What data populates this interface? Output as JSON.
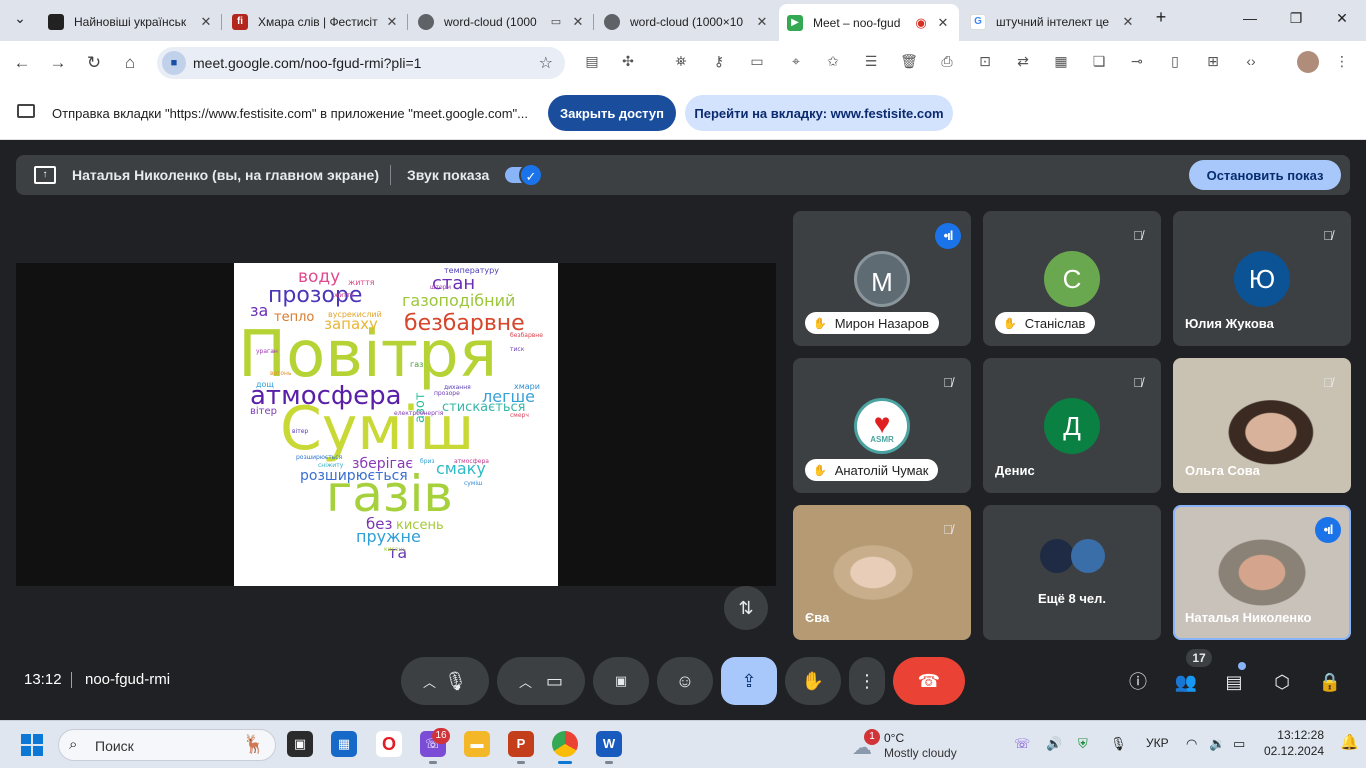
{
  "browser": {
    "tabs": [
      {
        "title": "Найновіші українськ",
        "favicon_color": "#222222",
        "favicon_glyph": ""
      },
      {
        "title": "Хмара слів | Фестисіт",
        "favicon_color": "#b3261e",
        "favicon_glyph": "fi"
      },
      {
        "title": "word-cloud (1000",
        "favicon_color": "#5f6368",
        "favicon_glyph": "◍"
      },
      {
        "title": "word-cloud (1000×10",
        "favicon_color": "#5f6368",
        "favicon_glyph": "◍"
      },
      {
        "title": "Meet – noo-fgud",
        "favicon_color": "#34a853",
        "favicon_glyph": "▶"
      },
      {
        "title": "штучний інтелект це",
        "favicon_color": "#4285f4",
        "favicon_glyph": "G"
      }
    ],
    "url": "meet.google.com/noo-fgud-rmi?pli=1",
    "new_tab_icon": "plus-icon",
    "extension_icons": [
      "pdf-icon",
      "puzzle-icon",
      "spy-icon",
      "key-icon",
      "card-icon",
      "location-icon",
      "star-icon",
      "notes-icon",
      "trash-icon",
      "print-icon",
      "screenshot-icon",
      "translate-icon",
      "qr-icon",
      "reader-icon",
      "link-icon",
      "devices-icon",
      "grid-icon",
      "code-icon"
    ]
  },
  "infobar": {
    "message": "Отправка вкладки \"https://www.festisite.com\" в приложение \"meet.google.com\"...",
    "stop_sharing": "Закрыть доступ",
    "goto_tab": "Перейти на вкладку: www.festisite.com"
  },
  "presenting": {
    "presenter": "Наталья Николенко (вы, на главном экране)",
    "sound_label": "Звук показа",
    "stop_label": "Остановить показ"
  },
  "wordcloud": {
    "words": [
      {
        "text": "Повітря",
        "color": "#b5d334"
      },
      {
        "text": "Суміш",
        "color": "#c8d936"
      },
      {
        "text": "газів",
        "color": "#a6d13d"
      },
      {
        "text": "атмосфера",
        "color": "#5a1fa8"
      },
      {
        "text": "безбарвне",
        "color": "#d5462b"
      },
      {
        "text": "прозоре",
        "color": "#4b36b8"
      },
      {
        "text": "газоподібний",
        "color": "#9cc63a"
      },
      {
        "text": "стан",
        "color": "#6b2fb3"
      },
      {
        "text": "воду",
        "color": "#e04a8f"
      },
      {
        "text": "запаху",
        "color": "#e8b534"
      },
      {
        "text": "легше",
        "color": "#3aa0d8"
      },
      {
        "text": "стискається",
        "color": "#38b7a8"
      },
      {
        "text": "зберігає",
        "color": "#8a39b8"
      },
      {
        "text": "смаку",
        "color": "#30b9c6"
      },
      {
        "text": "розширюється",
        "color": "#3a6fd0"
      },
      {
        "text": "кисень",
        "color": "#a6c93a"
      },
      {
        "text": "пружне",
        "color": "#2f9fd6"
      },
      {
        "text": "без",
        "color": "#7a36b0"
      },
      {
        "text": "та",
        "color": "#6a3ab0"
      },
      {
        "text": "за",
        "color": "#6b2fb3"
      },
      {
        "text": "тепло",
        "color": "#d97a2b"
      },
      {
        "text": "азот",
        "color": "#2fbf9a"
      },
      {
        "text": "вітер",
        "color": "#7b3db5"
      },
      {
        "text": "життя",
        "color": "#d94a8a"
      },
      {
        "text": "вусрекислий",
        "color": "#e0a52e"
      },
      {
        "text": "дихання",
        "color": "#5c3eb6"
      },
      {
        "text": "хмари",
        "color": "#2d8fd0"
      },
      {
        "text": "ураган",
        "color": "#a13ab5"
      },
      {
        "text": "бриз",
        "color": "#35a2d4"
      },
      {
        "text": "шторм",
        "color": "#a03bb0"
      },
      {
        "text": "температуру",
        "color": "#4d3fb6"
      },
      {
        "text": "смерч",
        "color": "#d7485e"
      },
      {
        "text": "вогонь",
        "color": "#e0932e"
      },
      {
        "text": "сніжиту",
        "color": "#35b0c8"
      },
      {
        "text": "прозоре",
        "color": "#6c3cb6"
      },
      {
        "text": "суміш",
        "color": "#3a8bd4"
      },
      {
        "text": "кисень",
        "color": "#9fc83a"
      },
      {
        "text": "дощ",
        "color": "#2fa0d6"
      },
      {
        "text": "атмосфера",
        "color": "#c73a8e"
      },
      {
        "text": "тиск",
        "color": "#6c3fb8"
      },
      {
        "text": "газ",
        "color": "#4a9d3a"
      },
      {
        "text": "електроенергія",
        "color": "#7d3bb5"
      },
      {
        "text": "безбарвне",
        "color": "#dd3f4e"
      },
      {
        "text": "розширюється",
        "color": "#2d77d0"
      },
      {
        "text": "вітер",
        "color": "#5a3cb6"
      },
      {
        "text": "життя",
        "color": "#c93b8a"
      }
    ]
  },
  "participants": [
    {
      "name": "Мирон Назаров",
      "initial": "М",
      "avatar_color": "#5f6b73",
      "mic": "active",
      "chip": true
    },
    {
      "name": "Станіслав",
      "initial": "С",
      "avatar_color": "#6aa84f",
      "mic": "muted",
      "chip": true
    },
    {
      "name": "Юлия Жукова",
      "initial": "Ю",
      "avatar_color": "#0b5394",
      "mic": "muted",
      "chip": false
    },
    {
      "name": "Анатолій Чумак",
      "initial": "",
      "avatar_color": "#ffffff",
      "mic": "muted",
      "chip": true,
      "avatar_icon": "asmr-heart-icon",
      "avatar_text": "ASMR"
    },
    {
      "name": "Денис",
      "initial": "Д",
      "avatar_color": "#0b8043",
      "mic": "muted",
      "chip": false
    },
    {
      "name": "Ольга Сова",
      "initial": "",
      "avatar_color": "#c9c2b2",
      "mic": "muted",
      "chip": false,
      "video": true
    },
    {
      "name": "Єва",
      "initial": "",
      "avatar_color": "#e8cdb8",
      "mic": "muted",
      "chip": false,
      "video": true
    },
    {
      "name": "Ещё 8 чел.",
      "initial": "",
      "avatar_color": "#3c4043",
      "mic": "none",
      "chip": false
    },
    {
      "name": "Наталья Николенко",
      "initial": "",
      "avatar_color": "#c9c2bb",
      "mic": "active",
      "chip": false,
      "video": true,
      "highlight": true
    }
  ],
  "controls": {
    "time": "13:12",
    "meeting_code": "noo-fgud-rmi",
    "participant_count": "17"
  },
  "taskbar": {
    "search_placeholder": "Поиск",
    "viber_badge": "16",
    "weather_temp": "0°C",
    "weather_desc": "Mostly cloudy",
    "weather_badge": "1",
    "language": "УКР",
    "clock_time": "13:12:28",
    "clock_date": "02.12.2024"
  }
}
